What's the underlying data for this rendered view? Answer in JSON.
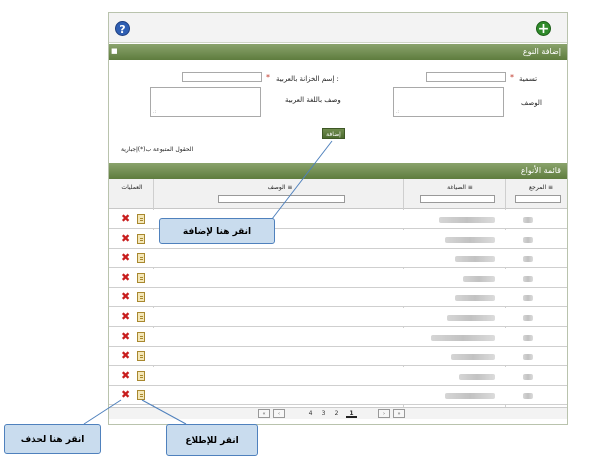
{
  "form": {
    "title": "إضافة النوع",
    "name_ar_label": "إسم الخزانة بالعربية :",
    "required_mark": "*",
    "name_label": "تسمية",
    "desc_ar_label": "وصف باللغة العربية",
    "desc_label": "الوصف",
    "add_button": "إضافة",
    "required_note": "الحقول المتبوعة ب(*)إجبارية"
  },
  "list": {
    "title": "قائمة الأنواع",
    "columns": {
      "ref": "المرجع ≡",
      "format": "الصياغة ≡",
      "description": "الوصف ≡",
      "actions": "العمليات"
    },
    "rows": [
      {
        "ref": "▒▒",
        "format": "▒▒▒▒▒▒▒▒▒▒▒▒"
      },
      {
        "ref": "▒▒",
        "format": "▒▒▒▒▒▒▒▒▒▒▒"
      },
      {
        "ref": "▒▒",
        "format": "▒▒▒▒▒▒"
      },
      {
        "ref": "▒▒",
        "format": "▒▒▒▒"
      },
      {
        "ref": "▒▒",
        "format": "▒▒▒▒"
      },
      {
        "ref": "▒▒",
        "format": "▒▒▒▒▒"
      },
      {
        "ref": "▒▒",
        "format": "▒▒▒▒▒▒▒▒▒"
      },
      {
        "ref": "▒▒",
        "format": "▒▒▒▒▒▒"
      },
      {
        "ref": "▒▒",
        "format": "▒▒▒▒"
      },
      {
        "ref": "▒▒",
        "format": "▒▒▒▒▒▒"
      }
    ]
  },
  "pager": {
    "first": "«",
    "prev": "‹",
    "pages": [
      "4",
      "3",
      "2",
      "1"
    ],
    "current": "1",
    "next": "›",
    "last": "»"
  },
  "callouts": {
    "add": "انقر هنا لإضافة",
    "delete": "انقر هنا لحذف",
    "view": "انقر للإطلاع"
  },
  "icons": {
    "help": "question-icon",
    "add": "plus-icon",
    "delete": "x-icon",
    "view": "notepad-icon"
  },
  "colors": {
    "section_bar": "#6b8a4b",
    "callout_fill": "#c9dcee",
    "callout_border": "#4f81bd",
    "delete": "#c81e1e"
  }
}
